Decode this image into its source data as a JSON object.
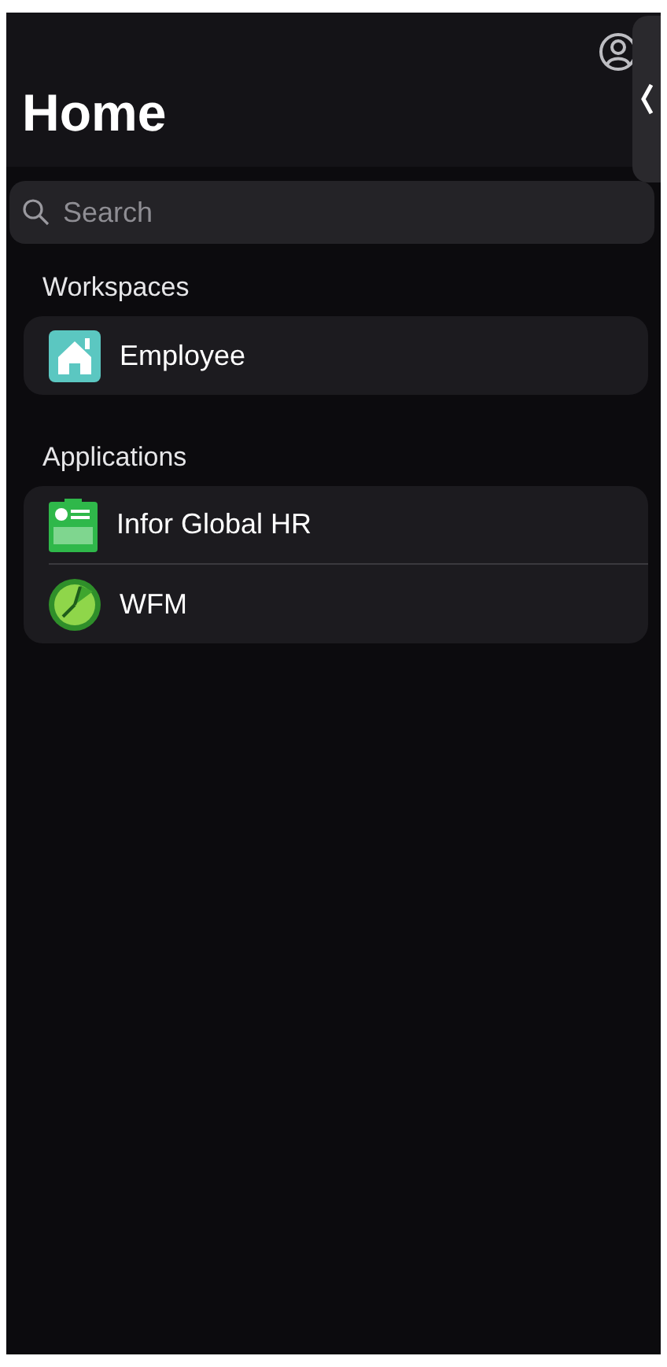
{
  "title": "Home",
  "search": {
    "placeholder": "Search"
  },
  "sections": [
    {
      "heading": "Workspaces",
      "items": [
        {
          "label": "Employee",
          "kind": "home"
        }
      ]
    },
    {
      "heading": "Applications",
      "items": [
        {
          "label": "Infor Global HR",
          "kind": "badge"
        },
        {
          "label": "WFM",
          "kind": "clock"
        }
      ]
    }
  ]
}
